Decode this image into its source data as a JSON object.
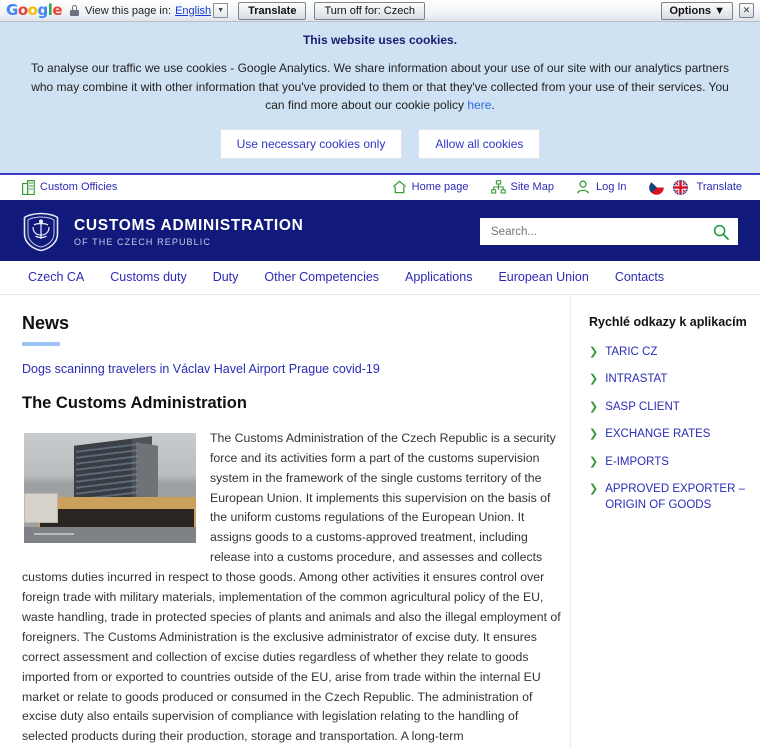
{
  "translate_bar": {
    "brand": "Google",
    "lock_icon": "lock-icon",
    "view_label": "View this page in:",
    "language": "English",
    "caret": "▼",
    "translate_button": "Translate",
    "turnoff_button": "Turn off for: Czech",
    "options_button": "Options",
    "options_caret": "▼",
    "close_button": "✕"
  },
  "cookie": {
    "title": "This website uses cookies.",
    "body_part1": "To analyse our traffic we use cookies - Google Analytics. We share information about your use of our site with our analytics partners who may combine it with other information that you've provided to them or that they've collected from your use of their services. You can find more about our cookie policy ",
    "link_text": "here",
    "body_part2": ".",
    "necessary_button": "Use necessary cookies only",
    "allow_button": "Allow all cookies"
  },
  "utility": {
    "custom_offices": "Custom Officies",
    "home_page": "Home page",
    "site_map": "Site Map",
    "log_in": "Log In",
    "translate": "Translate"
  },
  "brand": {
    "title": "CUSTOMS ADMINISTRATION",
    "subtitle": "OF THE CZECH REPUBLIC",
    "logo_icon": "customs-crest-icon"
  },
  "search": {
    "placeholder": "Search...",
    "value": "",
    "icon": "search-icon"
  },
  "nav": {
    "items": [
      {
        "label": "Czech CA"
      },
      {
        "label": "Customs duty"
      },
      {
        "label": "Duty"
      },
      {
        "label": "Other Competencies"
      },
      {
        "label": "Applications"
      },
      {
        "label": "European Union"
      },
      {
        "label": "Contacts"
      }
    ]
  },
  "main": {
    "news_heading": "News",
    "news_link": "Dogs scaninng travelers in  Václav Havel Airport Prague covid-19",
    "article_heading": "The Customs Administration",
    "article_body": "The Customs Administration of the Czech Republic is a security force and its activities form a part of the customs supervision system in the framework of the single customs territory of the European Union. It implements this supervision on the basis of the uniform customs regulations of the European Union. It assigns goods to a customs-approved treatment, including release into a customs procedure, and assesses and collects customs duties incurred in respect to those goods. Among other activities it ensures control over foreign trade with military materials, implementation of the common agricultural policy of the EU, waste handling, trade in protected species of plants and animals and also the illegal employment of foreigners. The Customs Administration is the exclusive administrator of excise duty. It ensures correct assessment and collection of excise duties regardless of whether they relate to goods imported from or exported to countries outside of the EU, arise from trade within the internal EU market or relate to goods produced or consumed in the Czech Republic. The administration of excise duty also entails supervision of compliance with legislation relating to the handling of selected products during their production, storage and transportation. A long-term",
    "photo_alt": "customs-administration-building-photo"
  },
  "sidebar": {
    "heading": "Rychlé odkazy k aplikacím",
    "items": [
      {
        "label": "TARIC CZ"
      },
      {
        "label": "INTRASTAT"
      },
      {
        "label": "SASP CLIENT"
      },
      {
        "label": "EXCHANGE RATES"
      },
      {
        "label": "E-IMPORTS"
      },
      {
        "label": "APPROVED EXPORTER – ORIGIN OF GOODS"
      }
    ]
  },
  "colors": {
    "brand_navy": "#11197a",
    "link_blue": "#2b2bb5",
    "accent_green": "#3c9a3c",
    "cookie_bg": "#cfe2f3",
    "news_rule": "#9fc5f8"
  }
}
